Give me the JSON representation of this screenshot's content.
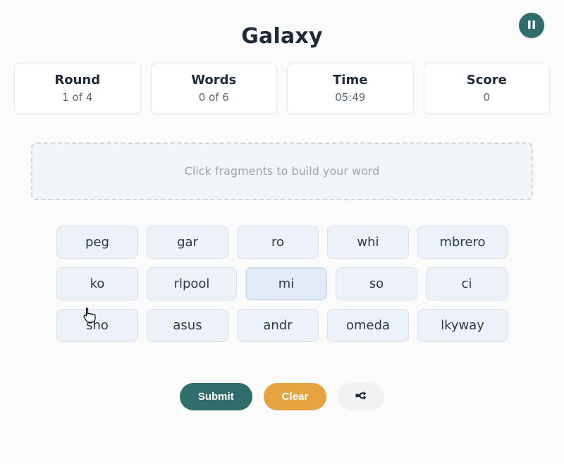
{
  "title": "Galaxy",
  "pause_icon": "pause-icon",
  "stats": {
    "round": {
      "label": "Round",
      "value": "1 of 4"
    },
    "words": {
      "label": "Words",
      "value": "0 of 6"
    },
    "time": {
      "label": "Time",
      "value": "05:49"
    },
    "score": {
      "label": "Score",
      "value": "0"
    }
  },
  "build_placeholder": "Click fragments to build your word",
  "fragments": [
    "peg",
    "gar",
    "ro",
    "whi",
    "mbrero",
    "ko",
    "rlpool",
    "mi",
    "so",
    "ci",
    "sho",
    "asus",
    "andr",
    "omeda",
    "lkyway"
  ],
  "hovered_index": 7,
  "actions": {
    "submit": "Submit",
    "clear": "Clear",
    "shuffle_icon": "shuffle-icon"
  }
}
